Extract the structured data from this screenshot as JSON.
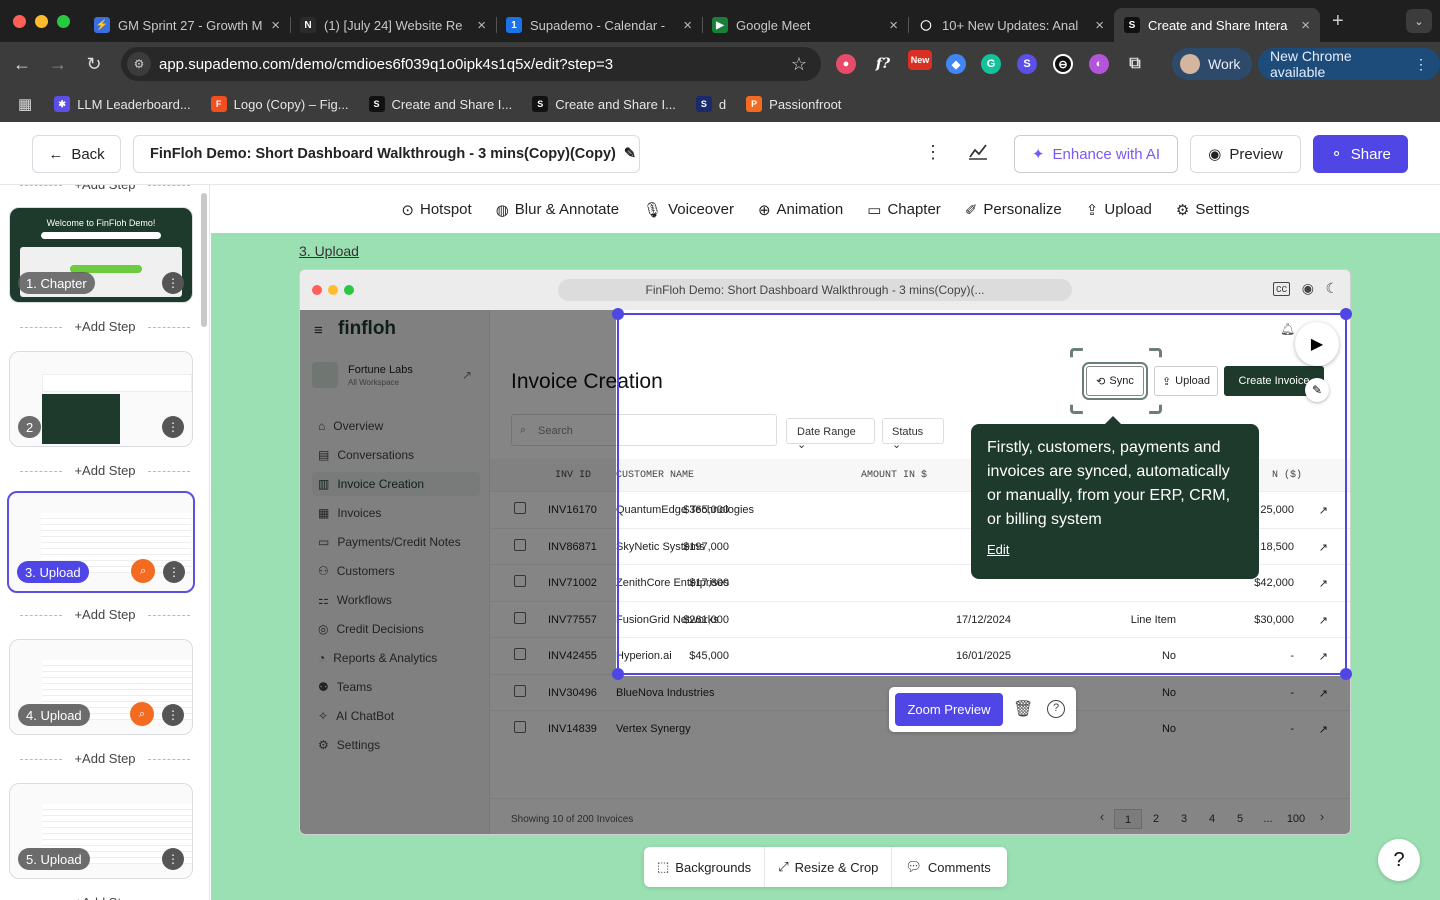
{
  "browser": {
    "tabs": [
      {
        "title": "GM Sprint 27 - Growth M",
        "icon_color": "#3b6fe0",
        "glyph": "⚡"
      },
      {
        "title": "(1) [July 24] Website Re",
        "icon_color": "#2b2b2b",
        "glyph": "N"
      },
      {
        "title": "Supademo - Calendar -",
        "icon_color": "#1a73e8",
        "glyph": "1"
      },
      {
        "title": "Google Meet",
        "icon_color": "#188038",
        "glyph": "▶"
      },
      {
        "title": "10+ New Updates: Anal",
        "icon_color": "#1f1f1f",
        "glyph": "◯"
      },
      {
        "title": "Create and Share Intera",
        "icon_color": "#111111",
        "glyph": "S"
      }
    ],
    "active_tab": 5,
    "new_tab": "+",
    "url": "app.supademo.com/demo/cmdioes6f039q1o0ipk4s1q5x/edit?step=3",
    "ext_new_badge": "New",
    "profile_label": "Work",
    "update_label": "New Chrome available",
    "bookmarks": [
      {
        "label": "LLM Leaderboard...",
        "color": "#5b4fe6",
        "glyph": "✱"
      },
      {
        "label": "Logo (Copy) – Fig...",
        "color": "#f24e1e",
        "glyph": "F"
      },
      {
        "label": "Create and Share I...",
        "color": "#111111",
        "glyph": "S"
      },
      {
        "label": "Create and Share I...",
        "color": "#111111",
        "glyph": "S"
      },
      {
        "label": "d",
        "color": "#1a2a6b",
        "glyph": "S"
      },
      {
        "label": "Passionfroot",
        "color": "#f26b21",
        "glyph": "P"
      }
    ]
  },
  "header": {
    "back_label": "Back",
    "demo_title": "FinFloh Demo: Short Dashboard Walkthrough - 3 mins(Copy)(Copy)",
    "enhance_label": "Enhance with AI",
    "preview_label": "Preview",
    "share_label": "Share"
  },
  "sidebar": {
    "add_step_label": "+Add Step",
    "steps": [
      {
        "label": "1. Chapter",
        "caption": "Welcome to FinFloh Demo!"
      },
      {
        "label": "2"
      },
      {
        "label": "3. Upload"
      },
      {
        "label": "4. Upload"
      },
      {
        "label": "5. Upload"
      }
    ]
  },
  "toolbar": {
    "items": [
      "Hotspot",
      "Blur & Annotate",
      "Voiceover",
      "Animation",
      "Chapter",
      "Personalize",
      "Upload",
      "Settings"
    ]
  },
  "canvas": {
    "step_title": "3. Upload",
    "frame_title": "FinFloh Demo: Short Dashboard Walkthrough - 3 mins(Copy)(...",
    "app": {
      "logo": "finfloh",
      "org_name": "Fortune Labs",
      "org_sub": "All Workspace",
      "nav": [
        "Overview",
        "Conversations",
        "Invoice Creation",
        "Invoices",
        "Payments/Credit Notes",
        "Customers",
        "Workflows",
        "Credit Decisions",
        "Reports & Analytics",
        "Teams",
        "AI ChatBot",
        "Settings"
      ],
      "active_nav": 2,
      "page_title": "Invoice Creation",
      "search_placeholder": "Search",
      "filters": [
        "Date Range",
        "Status"
      ],
      "sync_label": "Sync",
      "upload_label": "Upload",
      "create_label": "Create Invoice",
      "columns": [
        "INV ID",
        "CUSTOMER NAME",
        "AMOUNT IN $",
        "N ($)"
      ],
      "rows": [
        {
          "id": "INV16170",
          "name": "QuantumEdge Technologies",
          "amount": "$365,000",
          "date": "",
          "type": "",
          "total": "25,000"
        },
        {
          "id": "INV86871",
          "name": "SkyNetic Systems",
          "amount": "$197,000",
          "date": "",
          "type": "",
          "total": "18,500"
        },
        {
          "id": "INV71002",
          "name": "ZenithCore Enterprises",
          "amount": "$17,600",
          "date": "",
          "type": "",
          "total": "$42,000"
        },
        {
          "id": "INV77557",
          "name": "FusionGrid Networks",
          "amount": "$261,000",
          "date": "17/12/2024",
          "type": "Line Item",
          "total": "$30,000"
        },
        {
          "id": "INV42455",
          "name": "Hyperion.ai",
          "amount": "$45,000",
          "date": "16/01/2025",
          "type": "No",
          "total": "-"
        },
        {
          "id": "INV30496",
          "name": "BlueNova Industries",
          "amount": "",
          "date": "",
          "type": "No",
          "total": "-"
        },
        {
          "id": "INV14839",
          "name": "Vertex Synergy",
          "amount": "",
          "date": "",
          "type": "No",
          "total": "-"
        }
      ],
      "footer_text": "Showing 10 of 200 Invoices",
      "pages": [
        "1",
        "2",
        "3",
        "4",
        "5",
        "...",
        "100"
      ]
    },
    "tooltip_text": "Firstly, customers, payments and invoices are synced, automatically or manually, from your ERP, CRM, or billing system",
    "tooltip_edit": "Edit",
    "zoom_preview_label": "Zoom Preview"
  },
  "bottom_bar": {
    "items": [
      "Backgrounds",
      "Resize & Crop",
      "Comments"
    ]
  },
  "help_label": "?"
}
